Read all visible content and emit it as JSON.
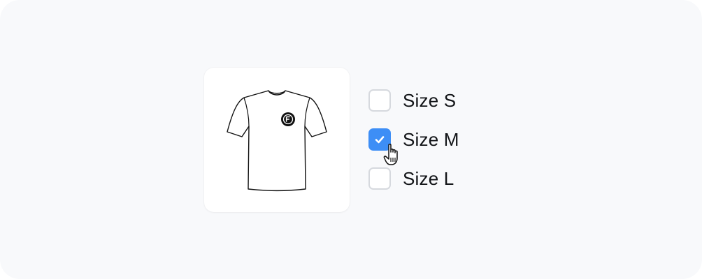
{
  "product": {
    "image_icon": "tshirt-icon",
    "logo_icon": "brand-logo-icon"
  },
  "size_options": [
    {
      "label": "Size S",
      "checked": false
    },
    {
      "label": "Size M",
      "checked": true
    },
    {
      "label": "Size L",
      "checked": false
    }
  ],
  "colors": {
    "background": "#f8f9fb",
    "card": "#ffffff",
    "checkbox_border": "#d6d9de",
    "checkbox_checked": "#3d8ef6",
    "text": "#121417"
  },
  "cursor_icon": "hand-pointer-icon"
}
